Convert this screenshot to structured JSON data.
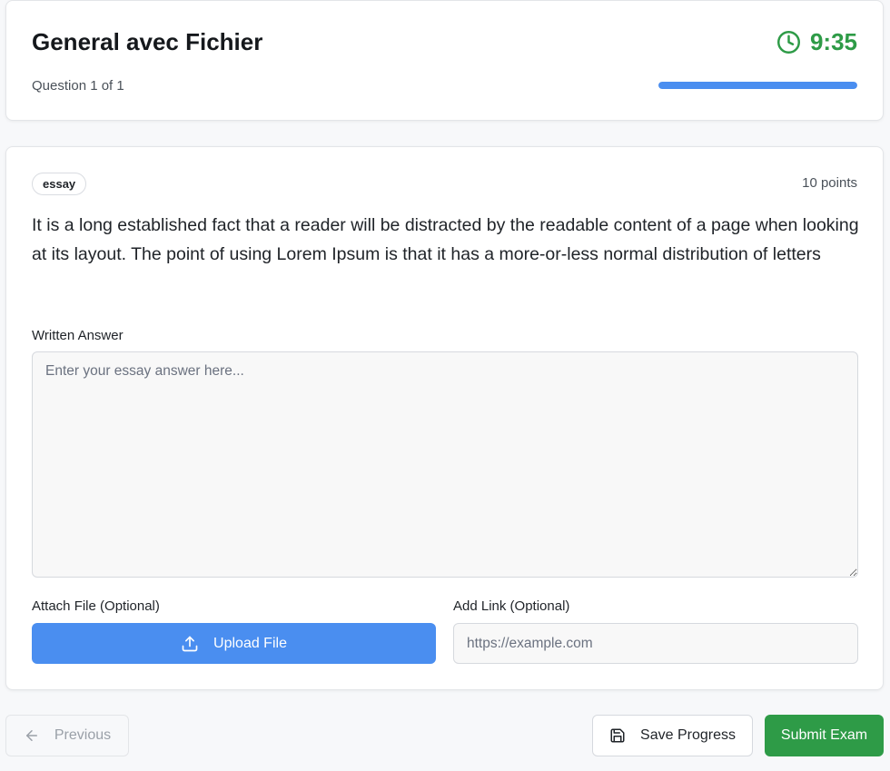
{
  "header": {
    "title": "General avec Fichier",
    "question_counter": "Question 1 of 1",
    "timer": "9:35",
    "timer_icon": "clock-icon",
    "progress_fraction": 1.0
  },
  "question": {
    "type_badge": "essay",
    "points": "10 points",
    "text": "It is a long established fact that a reader will be distracted by the readable content of a page when looking at its layout. The point of using Lorem Ipsum is that it has a more-or-less normal distribution of letters"
  },
  "answer": {
    "written_label": "Written Answer",
    "written_placeholder": "Enter your essay answer here...",
    "written_value": "",
    "attach_label": "Attach File (Optional)",
    "upload_label": "Upload File",
    "upload_icon": "upload-icon",
    "link_label": "Add Link (Optional)",
    "link_placeholder": "https://example.com",
    "link_value": ""
  },
  "footer": {
    "previous_label": "Previous",
    "previous_icon": "arrow-left-icon",
    "save_label": "Save Progress",
    "save_icon": "save-icon",
    "submit_label": "Submit Exam"
  },
  "colors": {
    "accent_blue": "#4a8ef0",
    "success_green": "#2e9b47",
    "page_background": "#f7f8fa"
  }
}
